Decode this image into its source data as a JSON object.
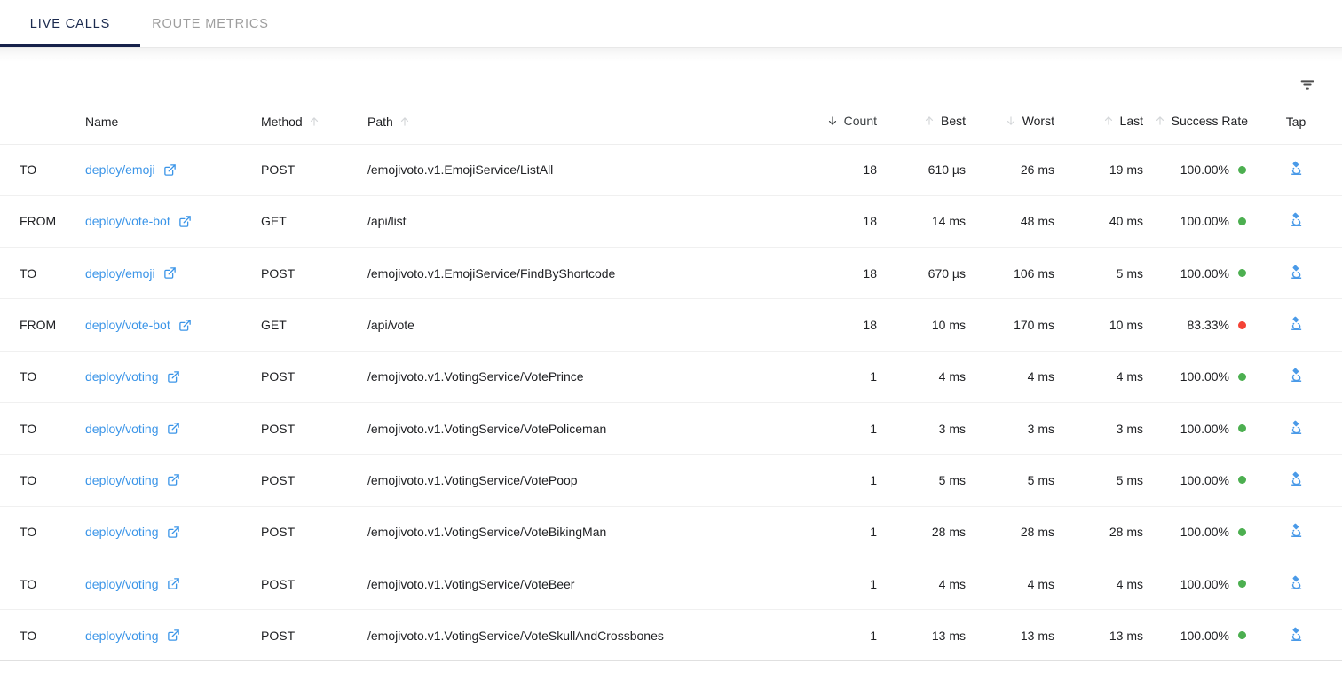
{
  "tabs": [
    {
      "label": "LIVE CALLS",
      "active": true
    },
    {
      "label": "ROUTE METRICS",
      "active": false
    }
  ],
  "toolbar": {
    "filter_icon": "filter-list-icon",
    "filter_label": "Filter"
  },
  "colors": {
    "link": "#3b95e8",
    "active_tab_underline": "#16214a",
    "success": "#4caf50",
    "failure": "#f44336",
    "tap_icon": "#4a9ae8"
  },
  "table": {
    "columns": [
      {
        "key": "direction",
        "label": "",
        "sort": null,
        "sorted": false
      },
      {
        "key": "name",
        "label": "Name",
        "sort": null,
        "sorted": false
      },
      {
        "key": "method",
        "label": "Method",
        "sort": "asc",
        "sorted": false
      },
      {
        "key": "path",
        "label": "Path",
        "sort": "asc",
        "sorted": false
      },
      {
        "key": "count",
        "label": "Count",
        "sort": "desc",
        "sorted": true
      },
      {
        "key": "best",
        "label": "Best",
        "sort": "asc",
        "sorted": false
      },
      {
        "key": "worst",
        "label": "Worst",
        "sort": "desc",
        "sorted": false
      },
      {
        "key": "last",
        "label": "Last",
        "sort": "asc",
        "sorted": false
      },
      {
        "key": "success_rate",
        "label": "Success Rate",
        "sort": "asc",
        "sorted": false
      },
      {
        "key": "tap",
        "label": "Tap",
        "sort": null,
        "sorted": false
      }
    ],
    "rows": [
      {
        "direction": "TO",
        "name": "deploy/emoji",
        "method": "POST",
        "path": "/emojivoto.v1.EmojiService/ListAll",
        "count": "18",
        "best": "610 µs",
        "worst": "26 ms",
        "last": "19 ms",
        "success_rate": "100.00%",
        "status": "ok",
        "tap_icon": "microscope-icon"
      },
      {
        "direction": "FROM",
        "name": "deploy/vote-bot",
        "method": "GET",
        "path": "/api/list",
        "count": "18",
        "best": "14 ms",
        "worst": "48 ms",
        "last": "40 ms",
        "success_rate": "100.00%",
        "status": "ok",
        "tap_icon": "microscope-icon"
      },
      {
        "direction": "TO",
        "name": "deploy/emoji",
        "method": "POST",
        "path": "/emojivoto.v1.EmojiService/FindByShortcode",
        "count": "18",
        "best": "670 µs",
        "worst": "106 ms",
        "last": "5 ms",
        "success_rate": "100.00%",
        "status": "ok",
        "tap_icon": "microscope-icon"
      },
      {
        "direction": "FROM",
        "name": "deploy/vote-bot",
        "method": "GET",
        "path": "/api/vote",
        "count": "18",
        "best": "10 ms",
        "worst": "170 ms",
        "last": "10 ms",
        "success_rate": "83.33%",
        "status": "fail",
        "tap_icon": "microscope-icon"
      },
      {
        "direction": "TO",
        "name": "deploy/voting",
        "method": "POST",
        "path": "/emojivoto.v1.VotingService/VotePrince",
        "count": "1",
        "best": "4 ms",
        "worst": "4 ms",
        "last": "4 ms",
        "success_rate": "100.00%",
        "status": "ok",
        "tap_icon": "microscope-icon"
      },
      {
        "direction": "TO",
        "name": "deploy/voting",
        "method": "POST",
        "path": "/emojivoto.v1.VotingService/VotePoliceman",
        "count": "1",
        "best": "3 ms",
        "worst": "3 ms",
        "last": "3 ms",
        "success_rate": "100.00%",
        "status": "ok",
        "tap_icon": "microscope-icon"
      },
      {
        "direction": "TO",
        "name": "deploy/voting",
        "method": "POST",
        "path": "/emojivoto.v1.VotingService/VotePoop",
        "count": "1",
        "best": "5 ms",
        "worst": "5 ms",
        "last": "5 ms",
        "success_rate": "100.00%",
        "status": "ok",
        "tap_icon": "microscope-icon"
      },
      {
        "direction": "TO",
        "name": "deploy/voting",
        "method": "POST",
        "path": "/emojivoto.v1.VotingService/VoteBikingMan",
        "count": "1",
        "best": "28 ms",
        "worst": "28 ms",
        "last": "28 ms",
        "success_rate": "100.00%",
        "status": "ok",
        "tap_icon": "microscope-icon"
      },
      {
        "direction": "TO",
        "name": "deploy/voting",
        "method": "POST",
        "path": "/emojivoto.v1.VotingService/VoteBeer",
        "count": "1",
        "best": "4 ms",
        "worst": "4 ms",
        "last": "4 ms",
        "success_rate": "100.00%",
        "status": "ok",
        "tap_icon": "microscope-icon"
      },
      {
        "direction": "TO",
        "name": "deploy/voting",
        "method": "POST",
        "path": "/emojivoto.v1.VotingService/VoteSkullAndCrossbones",
        "count": "1",
        "best": "13 ms",
        "worst": "13 ms",
        "last": "13 ms",
        "success_rate": "100.00%",
        "status": "ok",
        "tap_icon": "microscope-icon"
      }
    ]
  }
}
